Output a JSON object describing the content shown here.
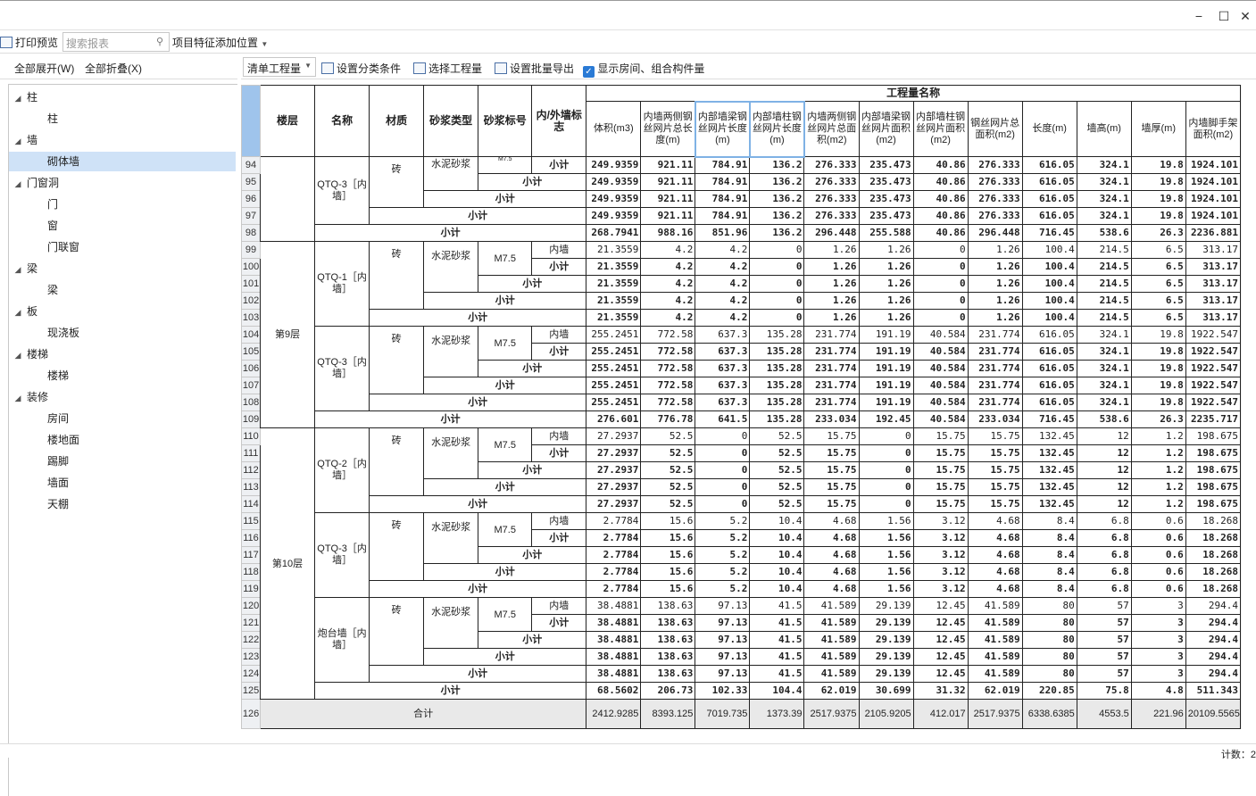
{
  "window": {
    "minimize": "−",
    "maximize": "☐",
    "close": "✕"
  },
  "toolbar1": {
    "print_preview": "打印预览",
    "search_placeholder": "搜索报表",
    "feature_add": "项目特征添加位置"
  },
  "left_panel": {
    "expand_all": "全部展开(W)",
    "collapse_all": "全部折叠(X)",
    "tree": [
      {
        "label": "柱",
        "children": [
          "柱"
        ]
      },
      {
        "label": "墙",
        "children": [
          "砌体墙"
        ]
      },
      {
        "label": "门窗洞",
        "children": [
          "门",
          "窗",
          "门联窗"
        ]
      },
      {
        "label": "梁",
        "children": [
          "梁"
        ]
      },
      {
        "label": "板",
        "children": [
          "现浇板"
        ]
      },
      {
        "label": "楼梯",
        "children": [
          "楼梯"
        ]
      },
      {
        "label": "装修",
        "children": [
          "房间",
          "楼地面",
          "踢脚",
          "墙面",
          "天棚"
        ]
      }
    ],
    "selected": "砌体墙"
  },
  "toolbar2": {
    "combo": "清单工程量",
    "set_category": "设置分类条件",
    "select_qty": "选择工程量",
    "set_export": "设置批量导出",
    "show_rooms": "显示房间、组合构件量"
  },
  "table": {
    "headers": {
      "floor": "楼层",
      "name": "名称",
      "material": "材质",
      "mortar_type": "砂浆类型",
      "mortar_grade": "砂浆标号",
      "inout": "内/外墙标志",
      "qty_group": "工程量名称",
      "cols": [
        "体积(m3)",
        "内墙两侧钢丝网片总长度(m)",
        "内部墙梁钢丝网片长度(m)",
        "内部墙柱钢丝网片长度(m)",
        "内墙两侧钢丝网片总面积(m2)",
        "内部墙梁钢丝网片面积(m2)",
        "内部墙柱钢丝网片面积(m2)",
        "钢丝网片总面积(m2)",
        "长度(m)",
        "墙高(m)",
        "墙厚(m)",
        "内墙脚手架面积(m2)"
      ]
    },
    "rows": [
      {
        "n": "94",
        "label": "小计",
        "lvl": 5,
        "v": [
          "249.9359",
          "921.11",
          "784.91",
          "136.2",
          "276.333",
          "235.473",
          "40.86",
          "276.333",
          "616.05",
          "324.1",
          "19.8",
          "1924.101"
        ]
      },
      {
        "n": "95",
        "label": "小计",
        "lvl": 4,
        "v": [
          "249.9359",
          "921.11",
          "784.91",
          "136.2",
          "276.333",
          "235.473",
          "40.86",
          "276.333",
          "616.05",
          "324.1",
          "19.8",
          "1924.101"
        ]
      },
      {
        "n": "96",
        "label": "小计",
        "lvl": 3,
        "v": [
          "249.9359",
          "921.11",
          "784.91",
          "136.2",
          "276.333",
          "235.473",
          "40.86",
          "276.333",
          "616.05",
          "324.1",
          "19.8",
          "1924.101"
        ]
      },
      {
        "n": "97",
        "label": "小计",
        "lvl": 2,
        "v": [
          "249.9359",
          "921.11",
          "784.91",
          "136.2",
          "276.333",
          "235.473",
          "40.86",
          "276.333",
          "616.05",
          "324.1",
          "19.8",
          "1924.101"
        ]
      },
      {
        "n": "98",
        "label": "小计",
        "lvl": 1,
        "v": [
          "268.7941",
          "988.16",
          "851.96",
          "136.2",
          "296.448",
          "255.588",
          "40.86",
          "296.448",
          "716.45",
          "538.6",
          "26.3",
          "2236.881"
        ]
      },
      {
        "n": "99",
        "label": "内墙",
        "lvl": 6,
        "v": [
          "21.3559",
          "4.2",
          "4.2",
          "0",
          "1.26",
          "1.26",
          "0",
          "1.26",
          "100.4",
          "214.5",
          "6.5",
          "313.17"
        ]
      },
      {
        "n": "100",
        "label": "小计",
        "lvl": 5,
        "v": [
          "21.3559",
          "4.2",
          "4.2",
          "0",
          "1.26",
          "1.26",
          "0",
          "1.26",
          "100.4",
          "214.5",
          "6.5",
          "313.17"
        ]
      },
      {
        "n": "101",
        "label": "小计",
        "lvl": 4,
        "v": [
          "21.3559",
          "4.2",
          "4.2",
          "0",
          "1.26",
          "1.26",
          "0",
          "1.26",
          "100.4",
          "214.5",
          "6.5",
          "313.17"
        ]
      },
      {
        "n": "102",
        "label": "小计",
        "lvl": 3,
        "v": [
          "21.3559",
          "4.2",
          "4.2",
          "0",
          "1.26",
          "1.26",
          "0",
          "1.26",
          "100.4",
          "214.5",
          "6.5",
          "313.17"
        ]
      },
      {
        "n": "103",
        "label": "小计",
        "lvl": 2,
        "v": [
          "21.3559",
          "4.2",
          "4.2",
          "0",
          "1.26",
          "1.26",
          "0",
          "1.26",
          "100.4",
          "214.5",
          "6.5",
          "313.17"
        ]
      },
      {
        "n": "104",
        "label": "内墙",
        "lvl": 6,
        "v": [
          "255.2451",
          "772.58",
          "637.3",
          "135.28",
          "231.774",
          "191.19",
          "40.584",
          "231.774",
          "616.05",
          "324.1",
          "19.8",
          "1922.547"
        ]
      },
      {
        "n": "105",
        "label": "小计",
        "lvl": 5,
        "v": [
          "255.2451",
          "772.58",
          "637.3",
          "135.28",
          "231.774",
          "191.19",
          "40.584",
          "231.774",
          "616.05",
          "324.1",
          "19.8",
          "1922.547"
        ]
      },
      {
        "n": "106",
        "label": "小计",
        "lvl": 4,
        "v": [
          "255.2451",
          "772.58",
          "637.3",
          "135.28",
          "231.774",
          "191.19",
          "40.584",
          "231.774",
          "616.05",
          "324.1",
          "19.8",
          "1922.547"
        ]
      },
      {
        "n": "107",
        "label": "小计",
        "lvl": 3,
        "v": [
          "255.2451",
          "772.58",
          "637.3",
          "135.28",
          "231.774",
          "191.19",
          "40.584",
          "231.774",
          "616.05",
          "324.1",
          "19.8",
          "1922.547"
        ]
      },
      {
        "n": "108",
        "label": "小计",
        "lvl": 2,
        "v": [
          "255.2451",
          "772.58",
          "637.3",
          "135.28",
          "231.774",
          "191.19",
          "40.584",
          "231.774",
          "616.05",
          "324.1",
          "19.8",
          "1922.547"
        ]
      },
      {
        "n": "109",
        "label": "小计",
        "lvl": 1,
        "v": [
          "276.601",
          "776.78",
          "641.5",
          "135.28",
          "233.034",
          "192.45",
          "40.584",
          "233.034",
          "716.45",
          "538.6",
          "26.3",
          "2235.717"
        ]
      },
      {
        "n": "110",
        "label": "内墙",
        "lvl": 6,
        "v": [
          "27.2937",
          "52.5",
          "0",
          "52.5",
          "15.75",
          "0",
          "15.75",
          "15.75",
          "132.45",
          "12",
          "1.2",
          "198.675"
        ]
      },
      {
        "n": "111",
        "label": "小计",
        "lvl": 5,
        "v": [
          "27.2937",
          "52.5",
          "0",
          "52.5",
          "15.75",
          "0",
          "15.75",
          "15.75",
          "132.45",
          "12",
          "1.2",
          "198.675"
        ]
      },
      {
        "n": "112",
        "label": "小计",
        "lvl": 4,
        "v": [
          "27.2937",
          "52.5",
          "0",
          "52.5",
          "15.75",
          "0",
          "15.75",
          "15.75",
          "132.45",
          "12",
          "1.2",
          "198.675"
        ]
      },
      {
        "n": "113",
        "label": "小计",
        "lvl": 3,
        "v": [
          "27.2937",
          "52.5",
          "0",
          "52.5",
          "15.75",
          "0",
          "15.75",
          "15.75",
          "132.45",
          "12",
          "1.2",
          "198.675"
        ]
      },
      {
        "n": "114",
        "label": "小计",
        "lvl": 2,
        "v": [
          "27.2937",
          "52.5",
          "0",
          "52.5",
          "15.75",
          "0",
          "15.75",
          "15.75",
          "132.45",
          "12",
          "1.2",
          "198.675"
        ]
      },
      {
        "n": "115",
        "label": "内墙",
        "lvl": 6,
        "v": [
          "2.7784",
          "15.6",
          "5.2",
          "10.4",
          "4.68",
          "1.56",
          "3.12",
          "4.68",
          "8.4",
          "6.8",
          "0.6",
          "18.268"
        ]
      },
      {
        "n": "116",
        "label": "小计",
        "lvl": 5,
        "v": [
          "2.7784",
          "15.6",
          "5.2",
          "10.4",
          "4.68",
          "1.56",
          "3.12",
          "4.68",
          "8.4",
          "6.8",
          "0.6",
          "18.268"
        ]
      },
      {
        "n": "117",
        "label": "小计",
        "lvl": 4,
        "v": [
          "2.7784",
          "15.6",
          "5.2",
          "10.4",
          "4.68",
          "1.56",
          "3.12",
          "4.68",
          "8.4",
          "6.8",
          "0.6",
          "18.268"
        ]
      },
      {
        "n": "118",
        "label": "小计",
        "lvl": 3,
        "v": [
          "2.7784",
          "15.6",
          "5.2",
          "10.4",
          "4.68",
          "1.56",
          "3.12",
          "4.68",
          "8.4",
          "6.8",
          "0.6",
          "18.268"
        ]
      },
      {
        "n": "119",
        "label": "小计",
        "lvl": 2,
        "v": [
          "2.7784",
          "15.6",
          "5.2",
          "10.4",
          "4.68",
          "1.56",
          "3.12",
          "4.68",
          "8.4",
          "6.8",
          "0.6",
          "18.268"
        ]
      },
      {
        "n": "120",
        "label": "内墙",
        "lvl": 6,
        "v": [
          "38.4881",
          "138.63",
          "97.13",
          "41.5",
          "41.589",
          "29.139",
          "12.45",
          "41.589",
          "80",
          "57",
          "3",
          "294.4"
        ]
      },
      {
        "n": "121",
        "label": "小计",
        "lvl": 5,
        "v": [
          "38.4881",
          "138.63",
          "97.13",
          "41.5",
          "41.589",
          "29.139",
          "12.45",
          "41.589",
          "80",
          "57",
          "3",
          "294.4"
        ]
      },
      {
        "n": "122",
        "label": "小计",
        "lvl": 4,
        "v": [
          "38.4881",
          "138.63",
          "97.13",
          "41.5",
          "41.589",
          "29.139",
          "12.45",
          "41.589",
          "80",
          "57",
          "3",
          "294.4"
        ]
      },
      {
        "n": "123",
        "label": "小计",
        "lvl": 3,
        "v": [
          "38.4881",
          "138.63",
          "97.13",
          "41.5",
          "41.589",
          "29.139",
          "12.45",
          "41.589",
          "80",
          "57",
          "3",
          "294.4"
        ]
      },
      {
        "n": "124",
        "label": "小计",
        "lvl": 2,
        "v": [
          "38.4881",
          "138.63",
          "97.13",
          "41.5",
          "41.589",
          "29.139",
          "12.45",
          "41.589",
          "80",
          "57",
          "3",
          "294.4"
        ]
      },
      {
        "n": "125",
        "label": "小计",
        "lvl": 1,
        "v": [
          "68.5602",
          "206.73",
          "102.33",
          "104.4",
          "62.019",
          "30.699",
          "31.32",
          "62.019",
          "220.85",
          "75.8",
          "4.8",
          "511.343"
        ]
      },
      {
        "n": "126",
        "label": "合计",
        "lvl": 0,
        "v": [
          "2412.9285",
          "8393.125",
          "7019.735",
          "1373.39",
          "2517.9375",
          "2105.9205",
          "412.017",
          "2517.9375",
          "6338.6385",
          "4553.5",
          "221.96",
          "20109.5565"
        ]
      }
    ],
    "groups": {
      "floors": [
        {
          "label": "第9层",
          "start": 99,
          "span": 11
        },
        {
          "label": "第10层",
          "start": 110,
          "span": 16
        }
      ],
      "names": [
        {
          "label": "QTQ-3［内墙］",
          "start": 94,
          "span": 4
        },
        {
          "label": "QTQ-1［内墙］",
          "start": 99,
          "span": 5
        },
        {
          "label": "QTQ-3［内墙］",
          "start": 104,
          "span": 5
        },
        {
          "label": "QTQ-2［内墙］",
          "start": 110,
          "span": 5
        },
        {
          "label": "QTQ-3［内墙］",
          "start": 115,
          "span": 5
        },
        {
          "label": "炮台墙［内墙］",
          "start": 120,
          "span": 5
        }
      ],
      "material": "砖",
      "mortar_type": "水泥砂浆",
      "mortar_grade": "M7.5",
      "top_cut": "M7.5"
    }
  },
  "status": {
    "count": "计数：2"
  }
}
